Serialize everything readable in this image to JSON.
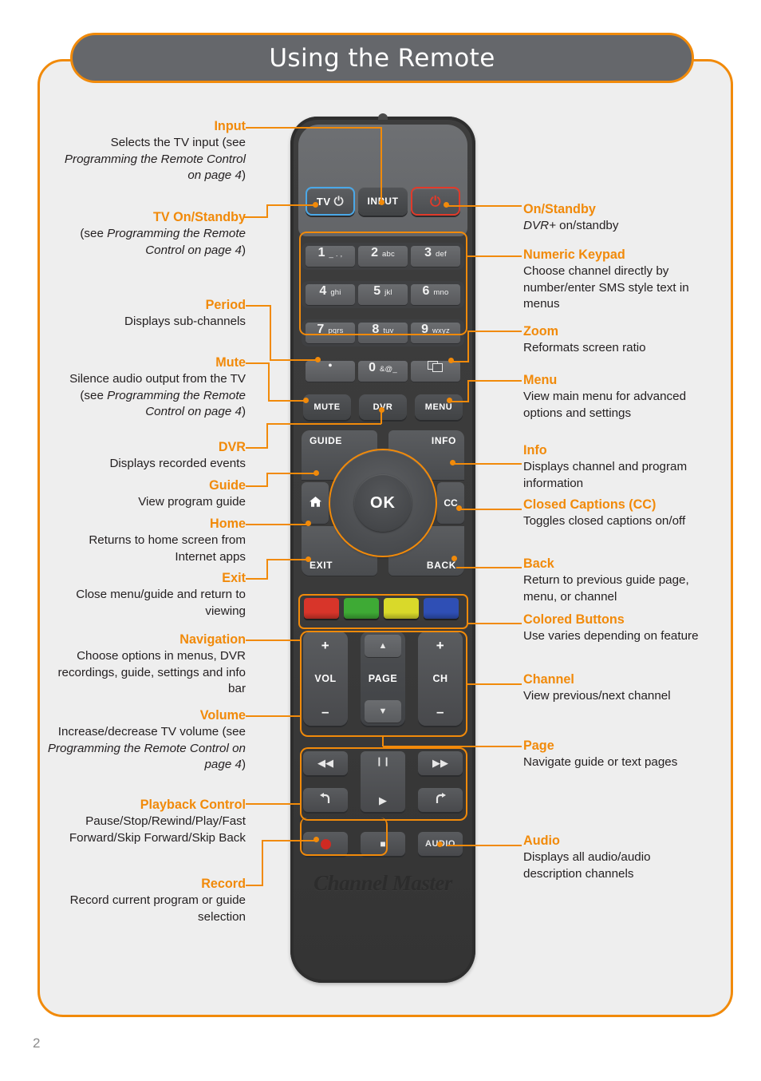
{
  "header": {
    "title": "Using the Remote"
  },
  "page_number": "2",
  "colors": {
    "accent_orange": "#f18a0a",
    "header_gray": "#65676b",
    "card_bg": "#eeeeee",
    "remote_body": "#3a3a3a",
    "tv_outline_blue": "#4aa8e8",
    "power_outline_red": "#e03a2a",
    "color_button_red": "#d8352a",
    "color_button_green": "#3eaa35",
    "color_button_yellow": "#d9d92a",
    "color_button_blue": "#2f4fb5"
  },
  "annotations_left": [
    {
      "title": "Input",
      "body": "Selects the TV input (see <em>Programming the Remote Control on page 4</em>)"
    },
    {
      "title": "TV On/Standby",
      "body": "(see <em>Programming the Remote Control on page 4</em>)"
    },
    {
      "title": "Period",
      "body": "Displays sub-channels"
    },
    {
      "title": "Mute",
      "body": "Silence audio output from the TV (see <em>Programming the Remote Control on page 4</em>)"
    },
    {
      "title": "DVR",
      "body": "Displays recorded events"
    },
    {
      "title": "Guide",
      "body": "View program guide"
    },
    {
      "title": "Home",
      "body": "Returns to home screen from Internet apps"
    },
    {
      "title": "Exit",
      "body": "Close menu/guide and return to viewing"
    },
    {
      "title": "Navigation",
      "body": "Choose options in menus, DVR recordings, guide, settings and info bar"
    },
    {
      "title": "Volume",
      "body": "Increase/decrease TV volume (see <em>Programming the Remote Control on page 4</em>)"
    },
    {
      "title": "Playback Control",
      "body": "Pause/Stop/Rewind/Play/Fast Forward/Skip Forward/Skip Back"
    },
    {
      "title": "Record",
      "body": "Record current program or guide selection"
    }
  ],
  "annotations_right": [
    {
      "title": "On/Standby",
      "body": "<em>DVR+</em> on/standby"
    },
    {
      "title": "Numeric Keypad",
      "body": "Choose channel directly by number/enter SMS style text in menus"
    },
    {
      "title": "Zoom",
      "body": "Reformats screen ratio"
    },
    {
      "title": "Menu",
      "body": "View main menu for advanced options and settings"
    },
    {
      "title": "Info",
      "body": "Displays channel and program information"
    },
    {
      "title": "Closed Captions (CC)",
      "body": "Toggles closed captions on/off"
    },
    {
      "title": "Back",
      "body": "Return to previous guide page, menu, or channel"
    },
    {
      "title": "Colored Buttons",
      "body": "Use varies depending on feature"
    },
    {
      "title": "Channel",
      "body": "View previous/next channel"
    },
    {
      "title": "Page",
      "body": "Navigate guide or text pages"
    },
    {
      "title": "Audio",
      "body": "Displays all audio/audio description channels"
    }
  ],
  "remote": {
    "top_row": {
      "tv_label": "TV",
      "tv_power_glyph": "⏻",
      "input_label": "INPUT",
      "power_glyph": "⏻"
    },
    "keypad": [
      {
        "num": "1",
        "letters": "_ . ,"
      },
      {
        "num": "2",
        "letters": "abc"
      },
      {
        "num": "3",
        "letters": "def"
      },
      {
        "num": "4",
        "letters": "ghi"
      },
      {
        "num": "5",
        "letters": "jkl"
      },
      {
        "num": "6",
        "letters": "mno"
      },
      {
        "num": "7",
        "letters": "pqrs"
      },
      {
        "num": "8",
        "letters": "tuv"
      },
      {
        "num": "9",
        "letters": "wxyz"
      }
    ],
    "bottom_keys": {
      "period_glyph": "●",
      "zero_num": "0",
      "zero_letters": "&@_",
      "zoom_icon": "zoom-icon"
    },
    "function_row": {
      "mute": "MUTE",
      "dvr": "DVR",
      "menu": "MENU"
    },
    "nav": {
      "guide": "GUIDE",
      "info": "INFO",
      "home_icon": "home-icon",
      "cc": "CC",
      "exit": "EXIT",
      "back": "BACK",
      "ok": "OK"
    },
    "color_buttons": [
      "red",
      "green",
      "yellow",
      "blue"
    ],
    "rockers": {
      "vol_plus": "+",
      "vol_label": "VOL",
      "vol_minus": "–",
      "page_up": "▲",
      "page_label": "PAGE",
      "page_down": "▼",
      "ch_plus": "+",
      "ch_label": "CH",
      "ch_minus": "–"
    },
    "playback": {
      "rewind": "◀◀",
      "pause": "❙❙",
      "forward": "▶▶",
      "skip_back": "skip-back-icon",
      "play": "▶",
      "skip_forward": "skip-forward-icon",
      "record": "record-icon",
      "stop": "■",
      "audio": "AUDIO"
    },
    "brand": "Channel Master"
  }
}
